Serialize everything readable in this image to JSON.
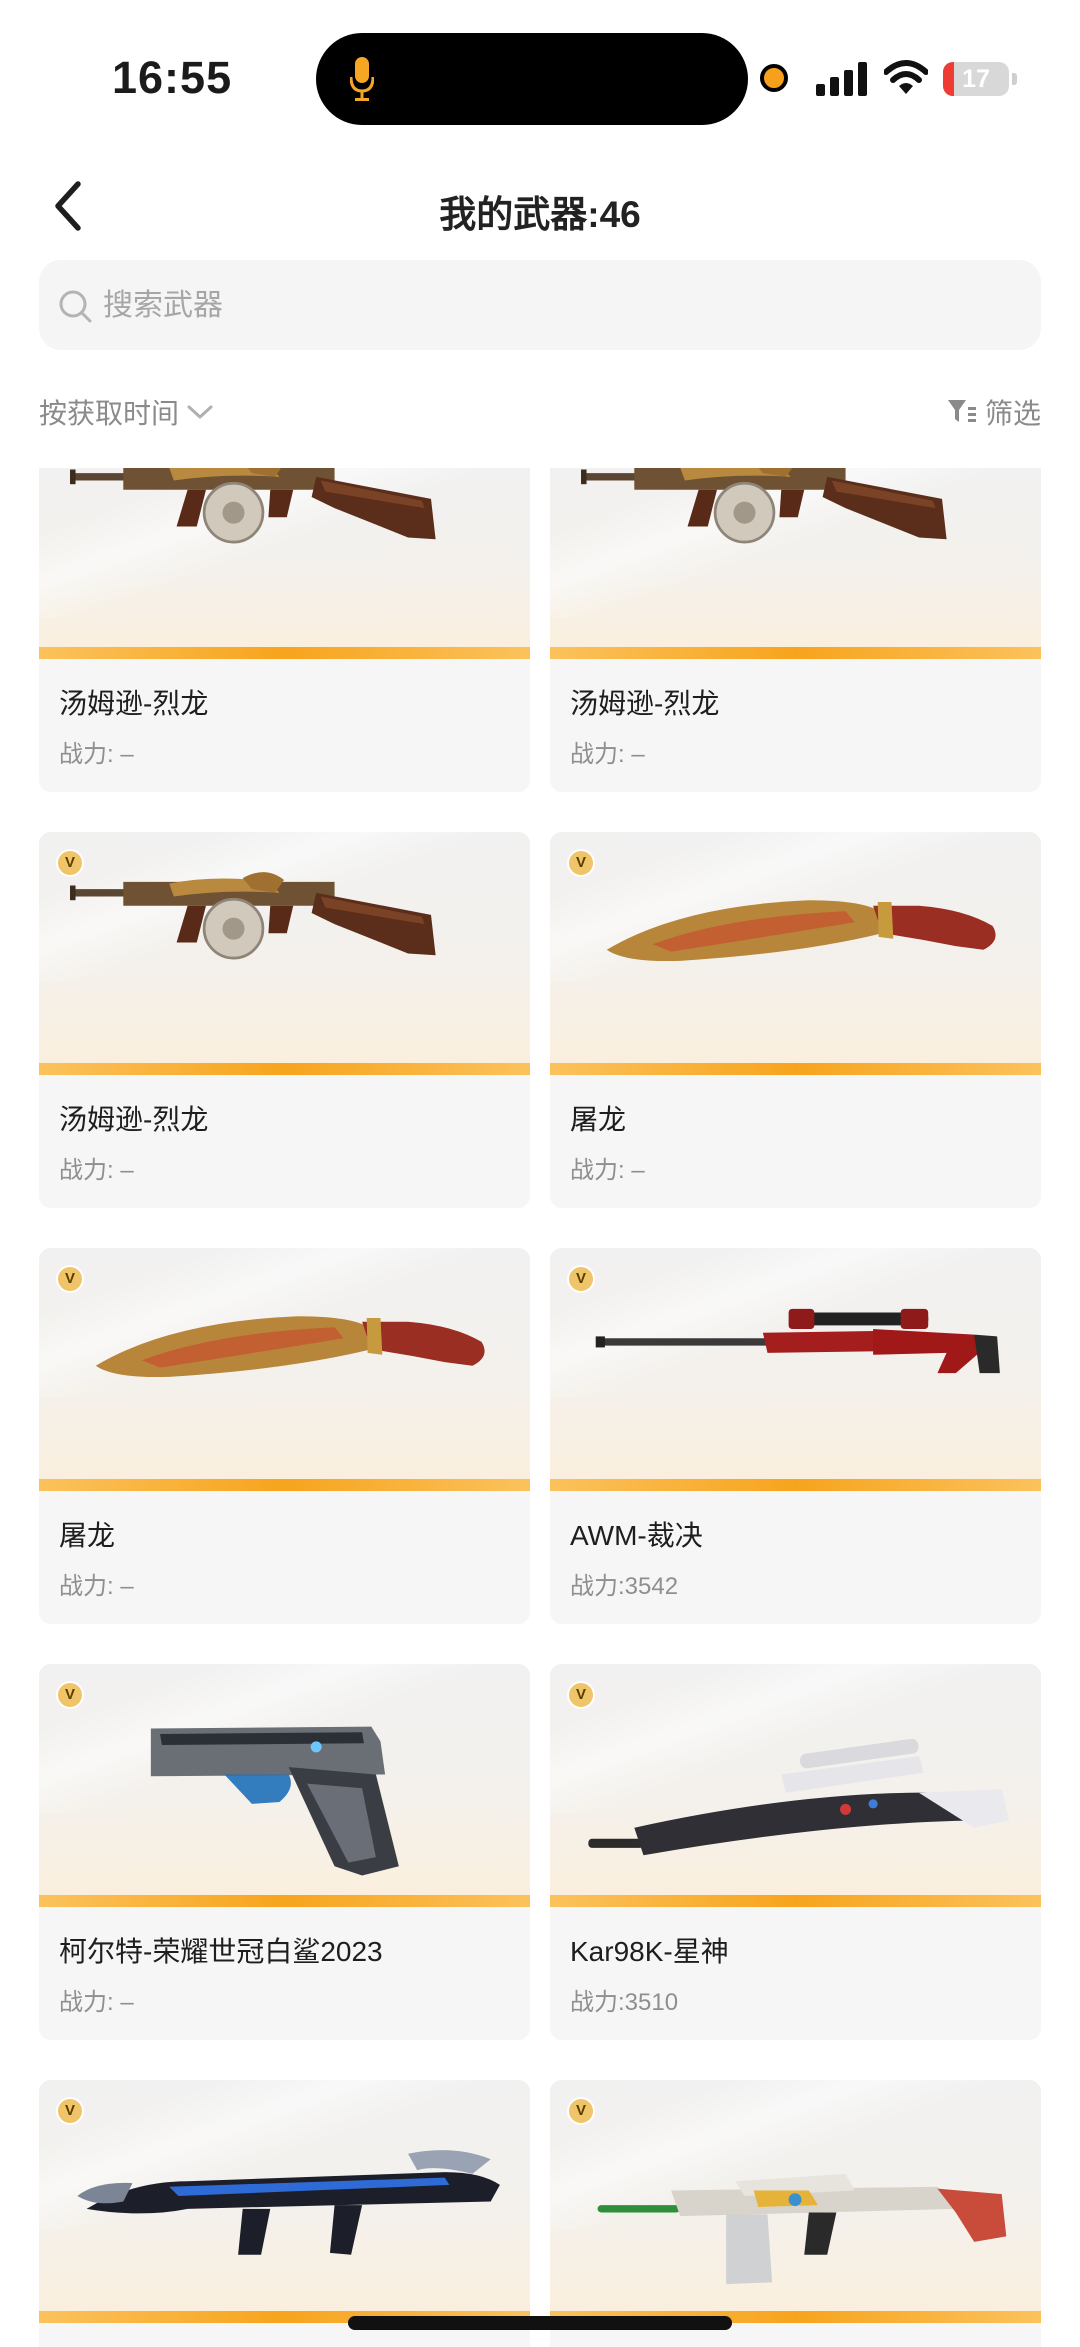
{
  "status_bar": {
    "time": "16:55",
    "battery": "17",
    "battery_level": 0.17
  },
  "header": {
    "title": "我的武器:46"
  },
  "search": {
    "placeholder": "搜索武器",
    "value": ""
  },
  "sort": {
    "label": "按获取时间"
  },
  "filter": {
    "label": "筛选"
  },
  "weapons": [
    {
      "name": "汤姆逊-烈龙",
      "power": "战力: –",
      "type": "tommy",
      "badge": false
    },
    {
      "name": "汤姆逊-烈龙",
      "power": "战力: –",
      "type": "tommy",
      "badge": false
    },
    {
      "name": "汤姆逊-烈龙",
      "power": "战力: –",
      "type": "tommy",
      "badge": true
    },
    {
      "name": "屠龙",
      "power": "战力: –",
      "type": "kukri",
      "badge": true
    },
    {
      "name": "屠龙",
      "power": "战力: –",
      "type": "kukri",
      "badge": true
    },
    {
      "name": "AWM-裁决",
      "power": "战力:3542",
      "type": "sniper-red",
      "badge": true
    },
    {
      "name": "柯尔特-荣耀世冠白鲨2023",
      "power": "战力: –",
      "type": "pistol",
      "badge": true
    },
    {
      "name": "Kar98K-星神",
      "power": "战力:3510",
      "type": "kar98",
      "badge": true
    },
    {
      "name": "",
      "power": "",
      "type": "blade-rifle",
      "badge": true
    },
    {
      "name": "",
      "power": "",
      "type": "lmg",
      "badge": true
    }
  ]
}
